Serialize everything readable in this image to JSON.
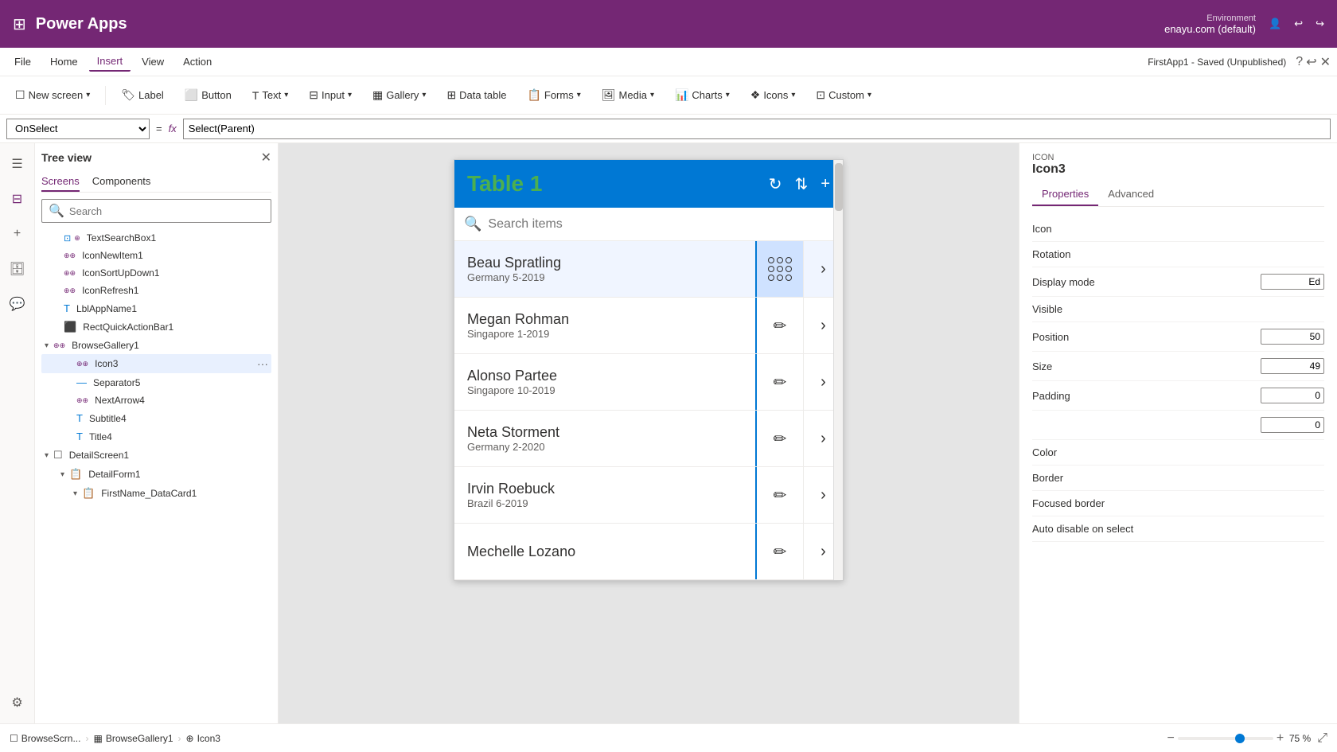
{
  "topbar": {
    "app_name": "Power Apps",
    "env_label": "Environment",
    "env_name": "enayu.com (default)"
  },
  "menubar": {
    "items": [
      "File",
      "Home",
      "Insert",
      "View",
      "Action"
    ],
    "active": "Insert",
    "right_text": "FirstApp1 - Saved (Unpublished)"
  },
  "toolbar": {
    "buttons": [
      {
        "id": "new-screen",
        "label": "New screen",
        "icon": "☐",
        "has_chevron": true
      },
      {
        "id": "label",
        "label": "Label",
        "icon": "🏷",
        "has_chevron": false
      },
      {
        "id": "button",
        "label": "Button",
        "icon": "⬜",
        "has_chevron": false
      },
      {
        "id": "text",
        "label": "Text",
        "icon": "T",
        "has_chevron": true
      },
      {
        "id": "input",
        "label": "Input",
        "icon": "⊟",
        "has_chevron": true
      },
      {
        "id": "gallery",
        "label": "Gallery",
        "icon": "▦",
        "has_chevron": true
      },
      {
        "id": "data-table",
        "label": "Data table",
        "icon": "⊞",
        "has_chevron": false
      },
      {
        "id": "forms",
        "label": "Forms",
        "icon": "📋",
        "has_chevron": true
      },
      {
        "id": "media",
        "label": "Media",
        "icon": "🖼",
        "has_chevron": true
      },
      {
        "id": "charts",
        "label": "Charts",
        "icon": "📊",
        "has_chevron": true
      },
      {
        "id": "icons",
        "label": "Icons",
        "icon": "❖",
        "has_chevron": true
      },
      {
        "id": "custom",
        "label": "Custom",
        "icon": "⊡",
        "has_chevron": true
      }
    ]
  },
  "formula_bar": {
    "select_value": "OnSelect",
    "formula_text": "Select(Parent)"
  },
  "tree_view": {
    "title": "Tree view",
    "tabs": [
      "Screens",
      "Components"
    ],
    "active_tab": "Screens",
    "search_placeholder": "Search",
    "items": [
      {
        "id": "text-search-box",
        "label": "TextSearchBox1",
        "icon": "T",
        "indent": 1,
        "type": "label"
      },
      {
        "id": "icon-new-item",
        "label": "IconNewItem1",
        "icon": "⊕",
        "indent": 1,
        "type": "icon"
      },
      {
        "id": "icon-sort-up-down",
        "label": "IconSortUpDown1",
        "icon": "⊕",
        "indent": 1,
        "type": "icon"
      },
      {
        "id": "icon-refresh",
        "label": "IconRefresh1",
        "icon": "⊕",
        "indent": 1,
        "type": "icon"
      },
      {
        "id": "lbl-app-name",
        "label": "LblAppName1",
        "icon": "T",
        "indent": 1,
        "type": "label"
      },
      {
        "id": "rect-quick-action",
        "label": "RectQuickActionBar1",
        "icon": "⬜",
        "indent": 1,
        "type": "rect"
      },
      {
        "id": "browse-gallery",
        "label": "BrowseGallery1",
        "icon": "▦",
        "indent": 0,
        "type": "gallery",
        "expanded": true
      },
      {
        "id": "icon3",
        "label": "Icon3",
        "icon": "⊕",
        "indent": 2,
        "type": "icon",
        "selected": true
      },
      {
        "id": "separator5",
        "label": "Separator5",
        "icon": "—",
        "indent": 2,
        "type": "sep"
      },
      {
        "id": "next-arrow4",
        "label": "NextArrow4",
        "icon": "⊕",
        "indent": 2,
        "type": "icon"
      },
      {
        "id": "subtitle4",
        "label": "Subtitle4",
        "icon": "T",
        "indent": 2,
        "type": "label"
      },
      {
        "id": "title4",
        "label": "Title4",
        "icon": "T",
        "indent": 2,
        "type": "label"
      },
      {
        "id": "detail-screen1",
        "label": "DetailScreen1",
        "icon": "☐",
        "indent": 0,
        "type": "screen",
        "expanded": true
      },
      {
        "id": "detail-form1",
        "label": "DetailForm1",
        "icon": "📋",
        "indent": 1,
        "type": "form",
        "expanded": true
      },
      {
        "id": "firstname-datacard1",
        "label": "FirstName_DataCard1",
        "icon": "📋",
        "indent": 2,
        "type": "form"
      }
    ]
  },
  "canvas": {
    "title": "Table 1",
    "search_placeholder": "Search items",
    "rows": [
      {
        "name": "Beau Spratling",
        "sub": "Germany 5-2019",
        "selected": true
      },
      {
        "name": "Megan Rohman",
        "sub": "Singapore 1-2019",
        "selected": false
      },
      {
        "name": "Alonso Partee",
        "sub": "Singapore 10-2019",
        "selected": false
      },
      {
        "name": "Neta Storment",
        "sub": "Germany 2-2020",
        "selected": false
      },
      {
        "name": "Irvin Roebuck",
        "sub": "Brazil 6-2019",
        "selected": false
      },
      {
        "name": "Mechelle Lozano",
        "sub": "",
        "selected": false
      }
    ]
  },
  "right_panel": {
    "icon_label": "ICON",
    "icon_value": "Icon3",
    "tabs": [
      "Properties",
      "Advanced"
    ],
    "active_tab": "Properties",
    "properties": [
      {
        "label": "Icon",
        "value": ""
      },
      {
        "label": "Rotation",
        "value": ""
      },
      {
        "label": "Display mode",
        "value": "Ed"
      },
      {
        "label": "Visible",
        "value": ""
      },
      {
        "label": "Position",
        "value": "50"
      },
      {
        "label": "Size",
        "value": "49"
      },
      {
        "label": "Padding",
        "value": "0"
      },
      {
        "label": "",
        "value": "0"
      },
      {
        "label": "Color",
        "value": ""
      },
      {
        "label": "Border",
        "value": ""
      },
      {
        "label": "Focused border",
        "value": ""
      },
      {
        "label": "Auto disable on select",
        "value": ""
      }
    ]
  },
  "bottom_bar": {
    "breadcrumbs": [
      "BrowseScrn...",
      "BrowseGallery1",
      "Icon3"
    ],
    "zoom_minus": "−",
    "zoom_plus": "+",
    "zoom_value": "75",
    "zoom_unit": "%"
  }
}
